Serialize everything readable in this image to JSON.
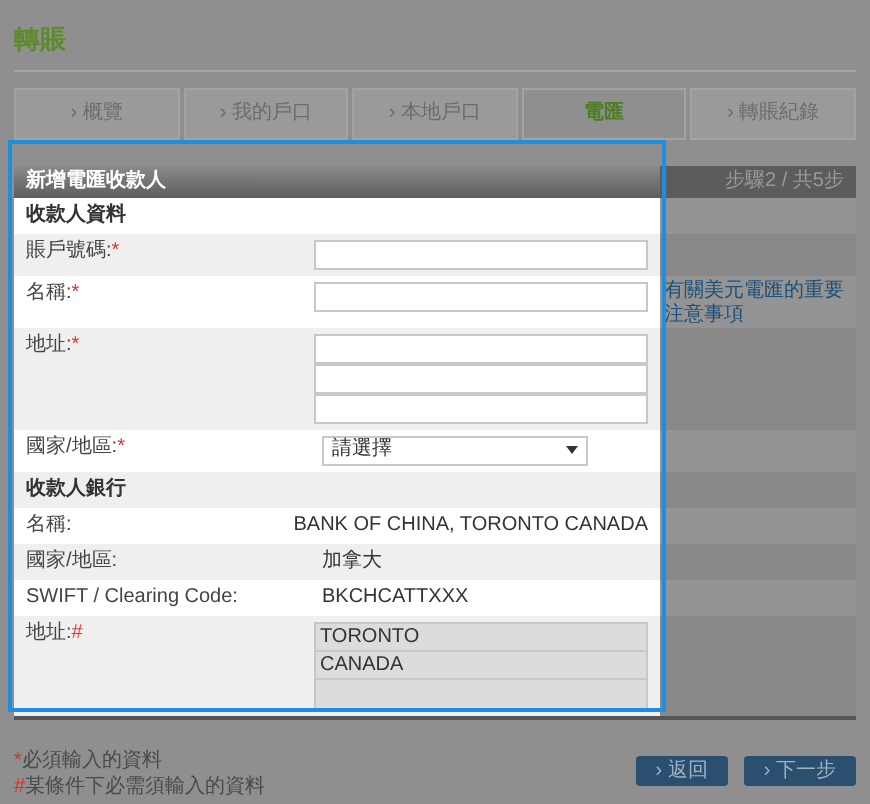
{
  "page_title": "轉賬",
  "tabs": [
    {
      "label": "› 概覽",
      "selected": false
    },
    {
      "label": "› 我的戶口",
      "selected": false
    },
    {
      "label": "› 本地戶口",
      "selected": false
    },
    {
      "label": "電匯",
      "selected": true
    },
    {
      "label": "› 轉賬紀錄",
      "selected": false
    }
  ],
  "panel": {
    "title": "新增電匯收款人",
    "step": "步驟2 / 共5步"
  },
  "sections": [
    {
      "heading": "收款人資料",
      "rows": [
        {
          "kind": "input",
          "label": "賬戶號碼:",
          "mark": "*"
        },
        {
          "kind": "input",
          "label": "名稱:",
          "mark": "*",
          "side_note": "有關美元電匯的重要注意事項"
        },
        {
          "kind": "address",
          "label": "地址:",
          "mark": "*"
        },
        {
          "kind": "select",
          "label": "國家/地區:",
          "mark": "*",
          "value": "請選擇"
        }
      ]
    },
    {
      "heading": "收款人銀行",
      "rows": [
        {
          "kind": "text",
          "label": "名稱:",
          "value": "BANK OF CHINA, TORONTO CANADA"
        },
        {
          "kind": "text",
          "label": "國家/地區:",
          "value": "加拿大"
        },
        {
          "kind": "text",
          "label": "SWIFT / Clearing Code:",
          "value": "BKCHCATTXXX"
        },
        {
          "kind": "readonly",
          "label": "地址:",
          "mark": "#",
          "lines": [
            "TORONTO",
            "CANADA"
          ]
        }
      ]
    }
  ],
  "footnotes": [
    {
      "mark": "*",
      "text": "必須輸入的資料"
    },
    {
      "mark": "#",
      "text": "某條件下必需須輸入的資料"
    }
  ],
  "buttons": [
    "› 返回",
    "› 下一步"
  ]
}
